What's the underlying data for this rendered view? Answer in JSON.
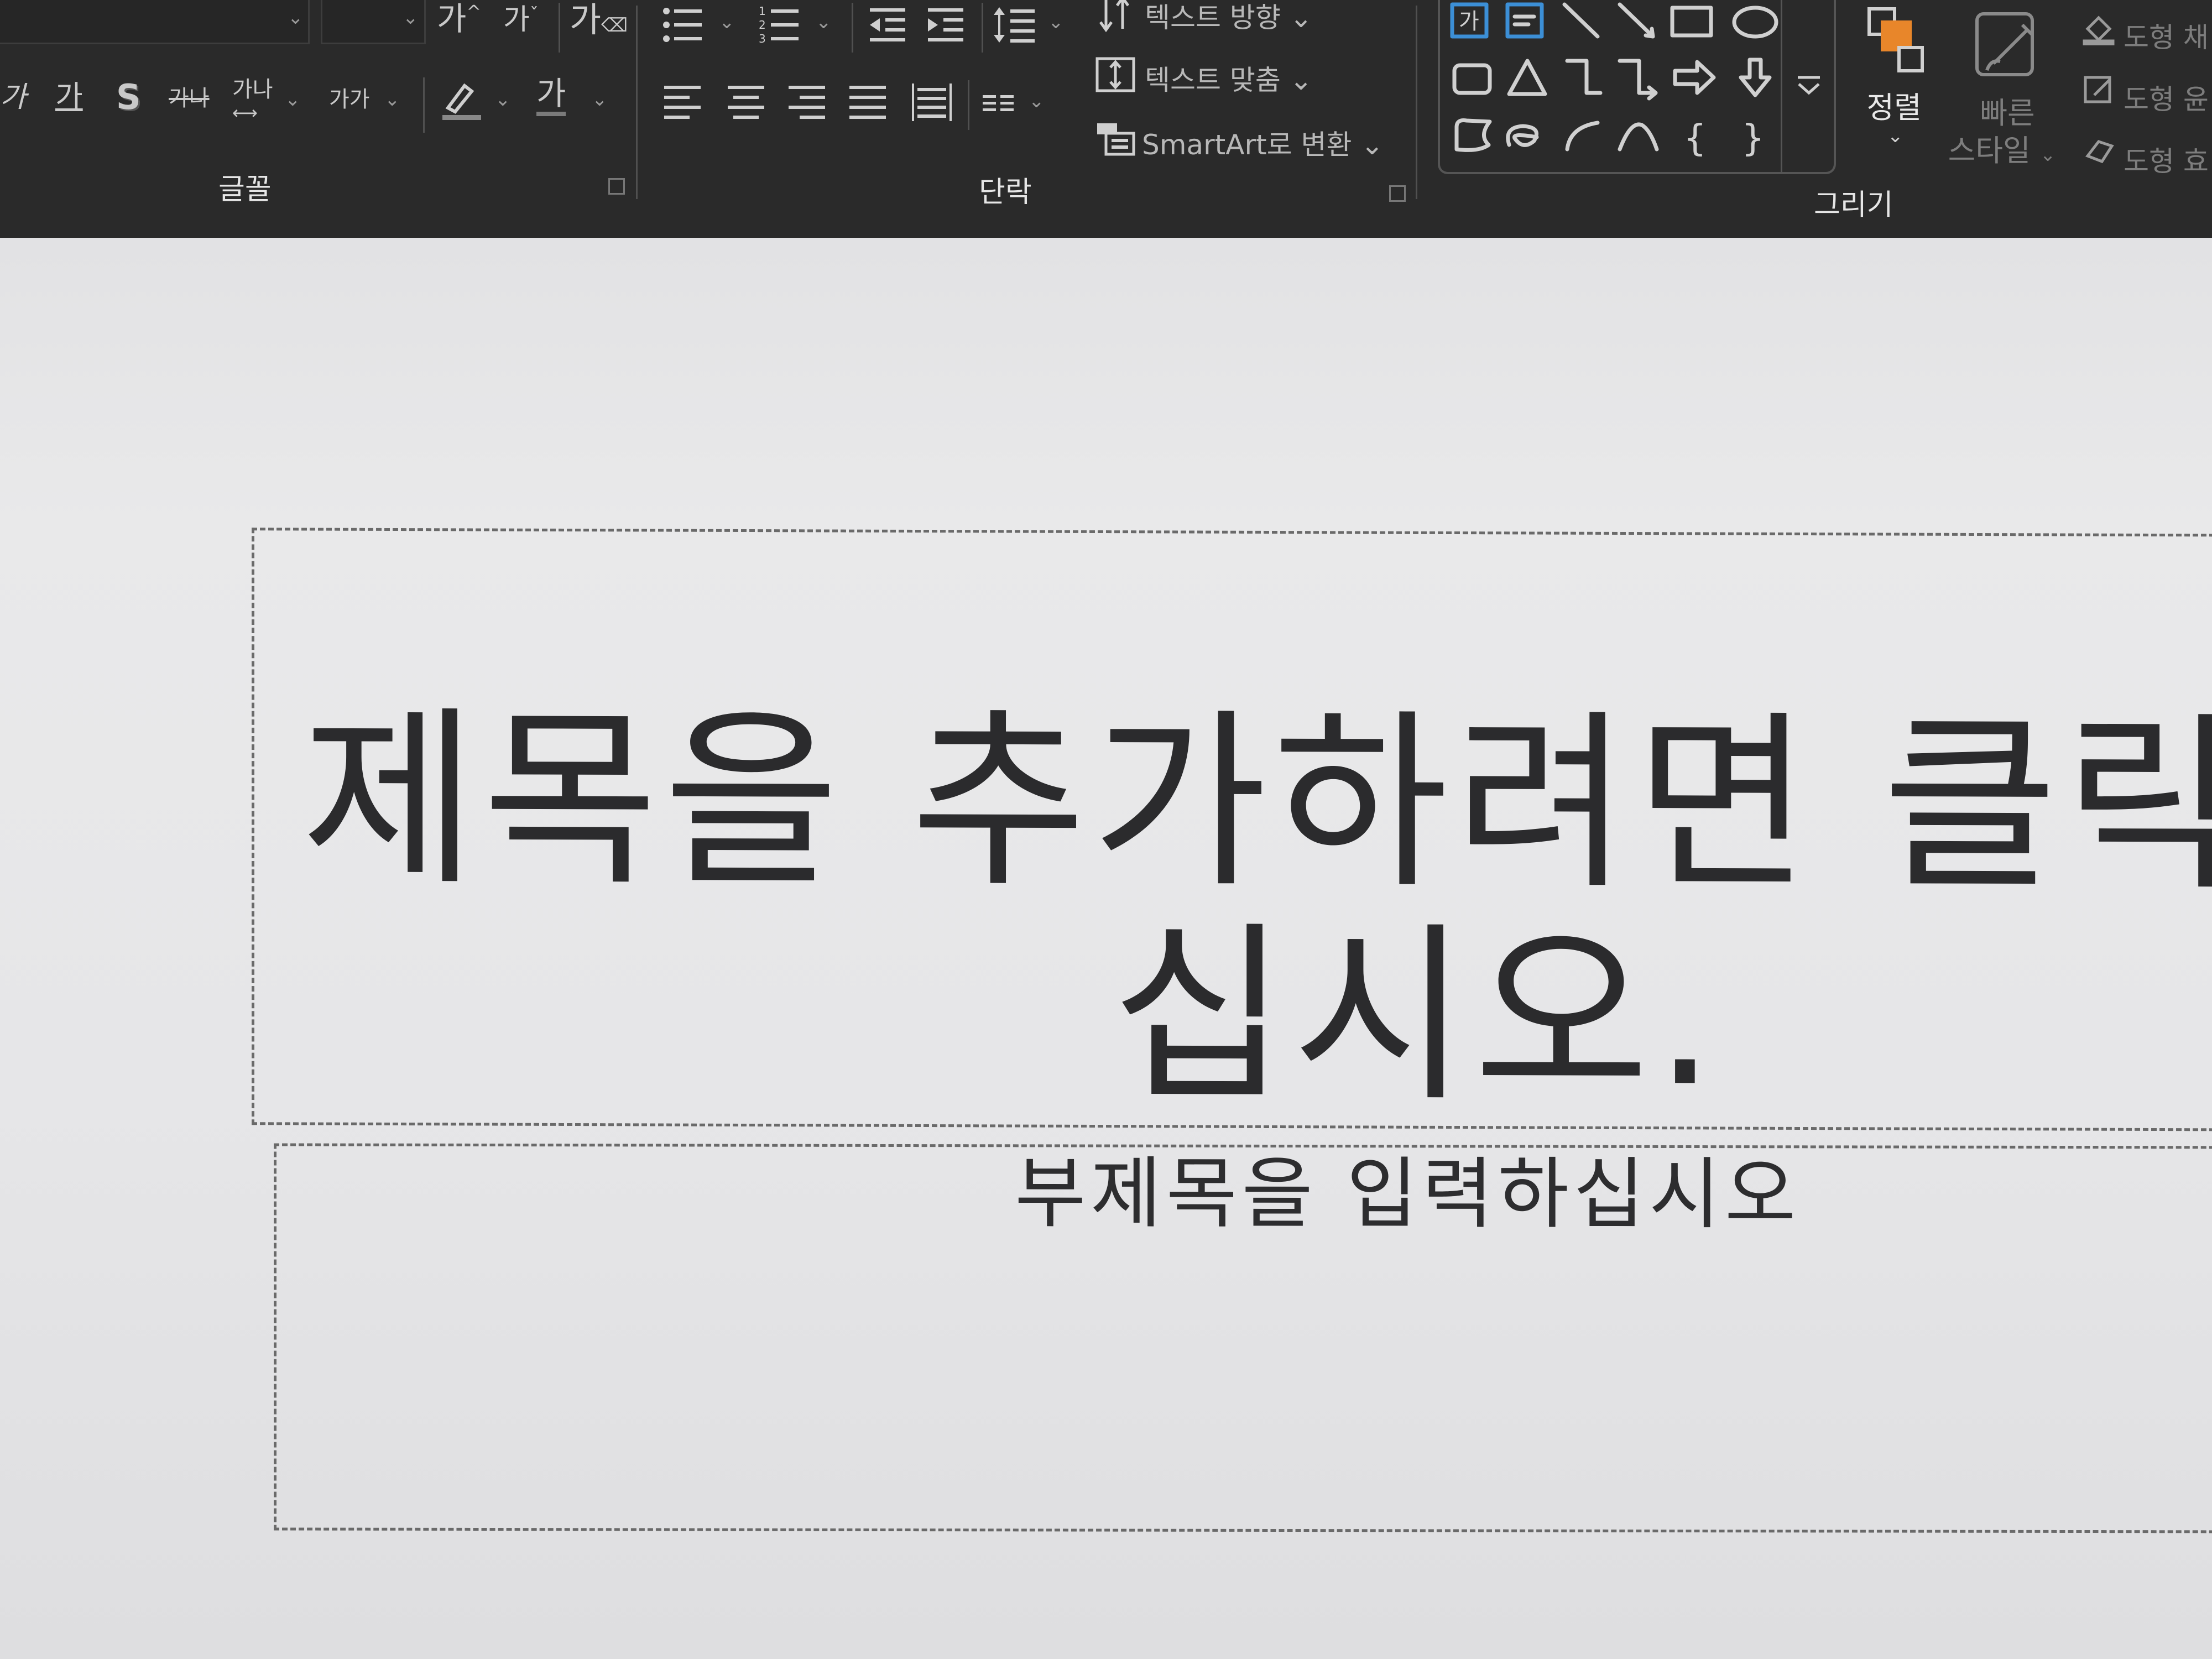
{
  "ribbon": {
    "font_group": {
      "label": "글꼴",
      "grow_font": "가",
      "shrink_font": "가",
      "clear_format": "가",
      "italic": "가",
      "underline": "가",
      "shadow": "S",
      "strikethrough": "가나",
      "char_spacing": "가나",
      "change_case": "가가",
      "font_color": "가"
    },
    "paragraph_group": {
      "label": "단락",
      "text_direction": "텍스트 방향",
      "align_text": "텍스트 맞춤",
      "smartart": "SmartArt로 변환"
    },
    "drawing_group": {
      "label": "그리기",
      "text_box_glyph": "가",
      "arrange": "정렬",
      "quick_styles_line1": "빠른",
      "quick_styles_line2": "스타일",
      "shape_fill": "도형 채",
      "shape_outline": "도형 윤",
      "shape_effects": "도형 효"
    }
  },
  "slide": {
    "title_line1": "제목을 추가하려면 클릭",
    "title_line2": "십시오.",
    "subtitle": "부제목을 입력하십시오"
  },
  "colors": {
    "ribbon_bg": "#2a2a2a",
    "slide_bg": "#e6e6e8",
    "accent_orange": "#e8862a"
  }
}
